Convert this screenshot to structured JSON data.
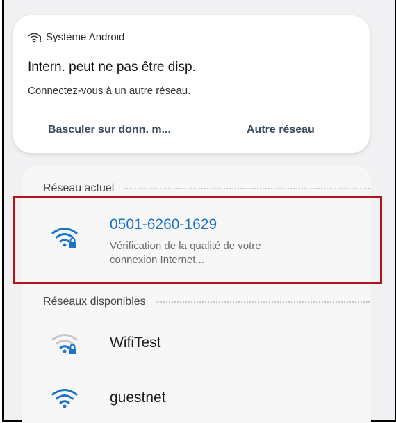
{
  "notification": {
    "app_name": "Système Android",
    "title": "Intern. peut ne pas être disp.",
    "body": "Connectez-vous à un autre réseau.",
    "actions": [
      "Basculer sur donn. m...",
      "Autre réseau"
    ]
  },
  "current_network": {
    "section_label": "Réseau actuel",
    "name": "0501-6260-1629",
    "status_line1": "Vérification de la qualité de votre",
    "status_line2": "connexion Internet...",
    "icon": "wifi-lock-icon",
    "color": "#1a73c8"
  },
  "available_networks": {
    "section_label": "Réseaux disponibles",
    "items": [
      {
        "name": "WifiTest",
        "icon": "wifi-lock-icon",
        "signal": "weak"
      },
      {
        "name": "guestnet",
        "icon": "wifi-icon",
        "signal": "strong"
      }
    ]
  },
  "colors": {
    "accent": "#1a73c8",
    "highlight_border": "#b5121b",
    "action_text": "#3b4d60"
  }
}
